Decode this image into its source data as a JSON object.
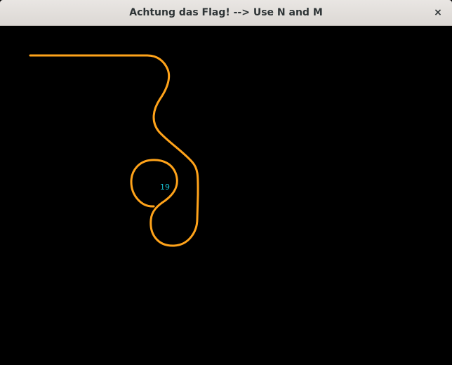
{
  "window": {
    "title": "Achtung das Flag! --> Use N and M",
    "close_icon": "close-icon",
    "close_glyph": "×"
  },
  "game": {
    "player": {
      "color": "#ffa31a",
      "score": "19",
      "score_color": "#17c3d6"
    }
  }
}
